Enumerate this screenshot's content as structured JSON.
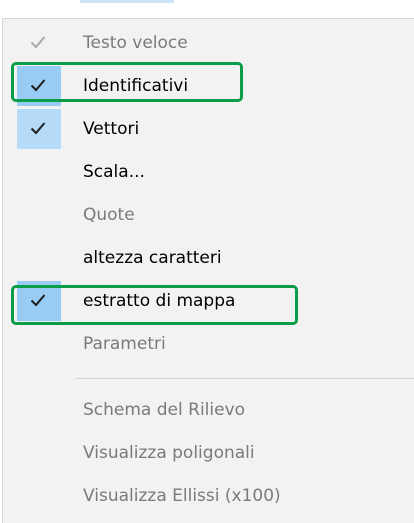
{
  "menu": {
    "items": [
      {
        "label": "Testo veloce",
        "checked": true,
        "enabled": false
      },
      {
        "label": "Identificativi",
        "checked": true,
        "enabled": true
      },
      {
        "label": "Vettori",
        "checked": true,
        "enabled": true
      },
      {
        "label": "Scala...",
        "checked": false,
        "enabled": true
      },
      {
        "label": "Quote",
        "checked": false,
        "enabled": false
      },
      {
        "label": "altezza caratteri",
        "checked": false,
        "enabled": true
      },
      {
        "label": "estratto di mappa",
        "checked": true,
        "enabled": true
      },
      {
        "label": "Parametri",
        "checked": false,
        "enabled": false
      },
      {
        "label": "Schema del Rilievo",
        "checked": false,
        "enabled": false
      },
      {
        "label": "Visualizza poligonali",
        "checked": false,
        "enabled": false
      },
      {
        "label": "Visualizza Ellissi (x100)",
        "checked": false,
        "enabled": false
      }
    ]
  },
  "colors": {
    "menu_background": "#f2f2f2",
    "check_background": "#99ccf5",
    "highlight_outline": "#0b9c47",
    "disabled_text": "#7a7a7a"
  },
  "icons": {
    "check": "checkmark-icon"
  }
}
